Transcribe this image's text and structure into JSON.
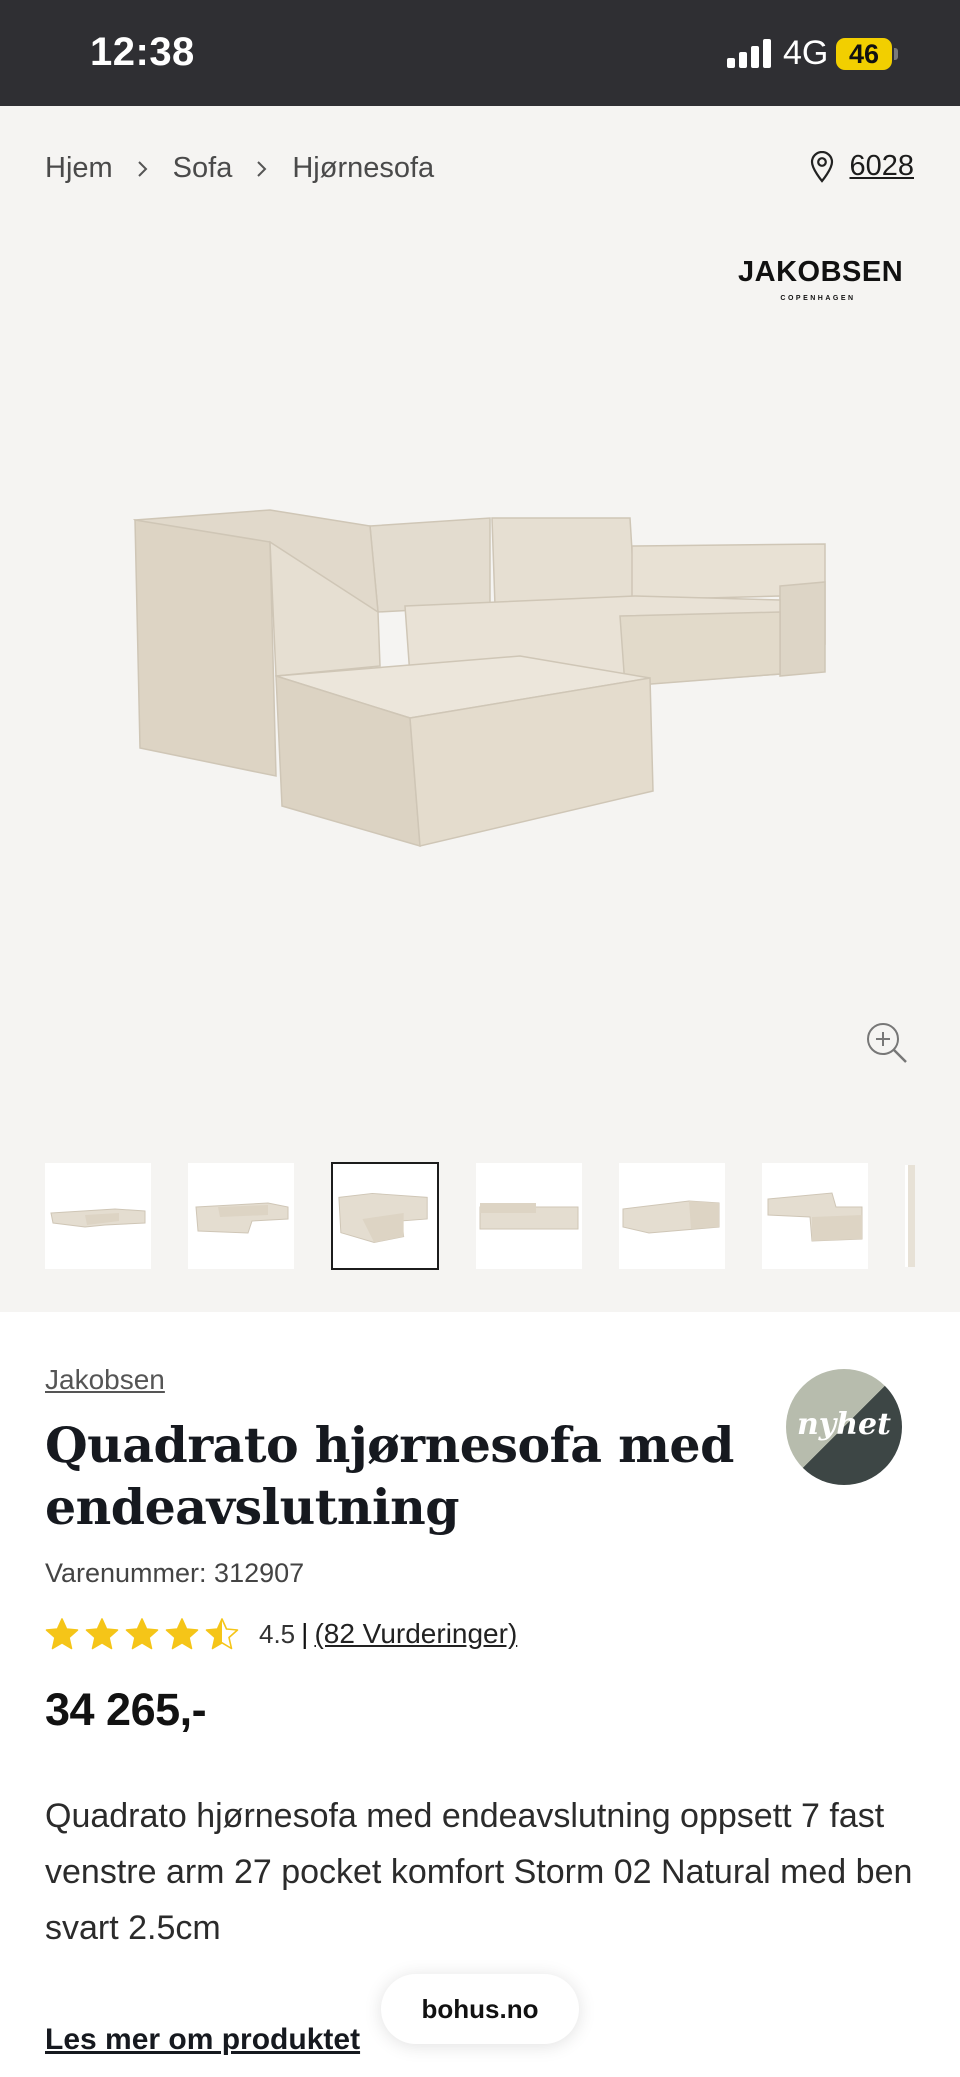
{
  "status_bar": {
    "time": "12:38",
    "network": "4G",
    "battery": "46"
  },
  "breadcrumb": [
    "Hjem",
    "Sofa",
    "Hjørnesofa"
  ],
  "store": {
    "code": "6028",
    "icon": "location-pin-icon"
  },
  "brand_logo": {
    "main": "JAKOBSEN",
    "sub": "COPENHAGEN"
  },
  "gallery": {
    "thumbnail_count": 6,
    "active_index": 2,
    "zoom_icon": "zoom-in-icon"
  },
  "product": {
    "brand": "Jakobsen",
    "badge": "nyhet",
    "title": "Quadrato hjørnesofa med endeavslutning",
    "sku": "Varenummer: 312907",
    "rating": 4.5,
    "rating_value_text": "4.5",
    "rating_separator": "|",
    "rating_count": "(82 Vurderinger)",
    "price": "34 265,-",
    "description": "Quadrato hjørnesofa med endeavslutning oppsett 7 fast venstre arm 27 pocket komfort Storm 02 Natural med ben svart 2.5cm",
    "read_more": "Les mer om produktet"
  },
  "browser": {
    "url": "bohus.no"
  },
  "colors": {
    "status_bar": "#2f2f33",
    "battery": "#f2cf00",
    "star": "#f5c518",
    "media_bg": "#f5f4f2",
    "sofa": "#e7e0d3"
  }
}
